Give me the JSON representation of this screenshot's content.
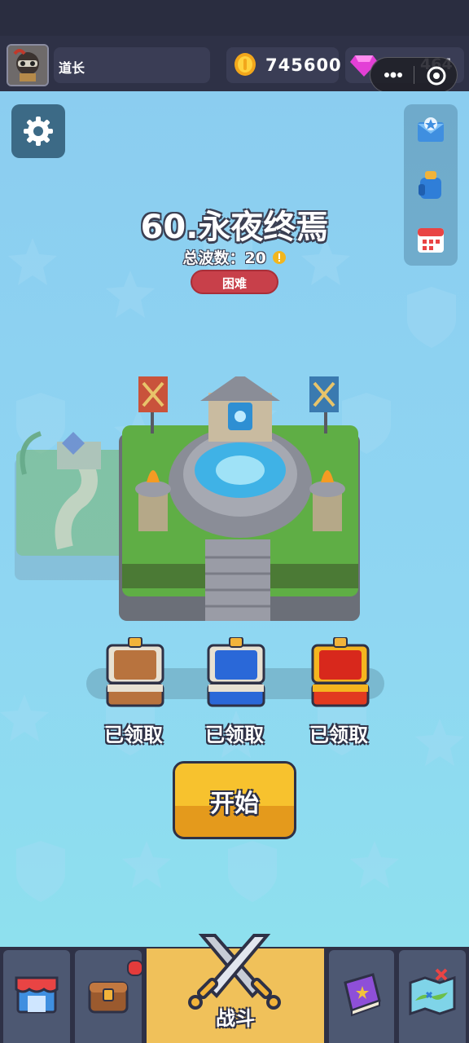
{
  "header": {
    "player_name": "道长",
    "coins": "745600",
    "gems": "464"
  },
  "level": {
    "title": "60.永夜终焉",
    "waves_label": "总波数：20",
    "difficulty": "困难"
  },
  "chests": [
    {
      "status": "已领取",
      "color": "#b8733e"
    },
    {
      "status": "已领取",
      "color": "#2a68d8"
    },
    {
      "status": "已领取",
      "color": "#e23a20"
    }
  ],
  "start_button": "开始",
  "nav": {
    "battle_label": "战斗",
    "items": [
      "shop-icon",
      "chest-icon",
      "battle-icon",
      "book-icon",
      "map-icon"
    ]
  },
  "colors": {
    "sky": "#8fd6f2",
    "accent": "#f7c22e",
    "difficulty": "#c8404a",
    "bar": "#2e3146"
  }
}
